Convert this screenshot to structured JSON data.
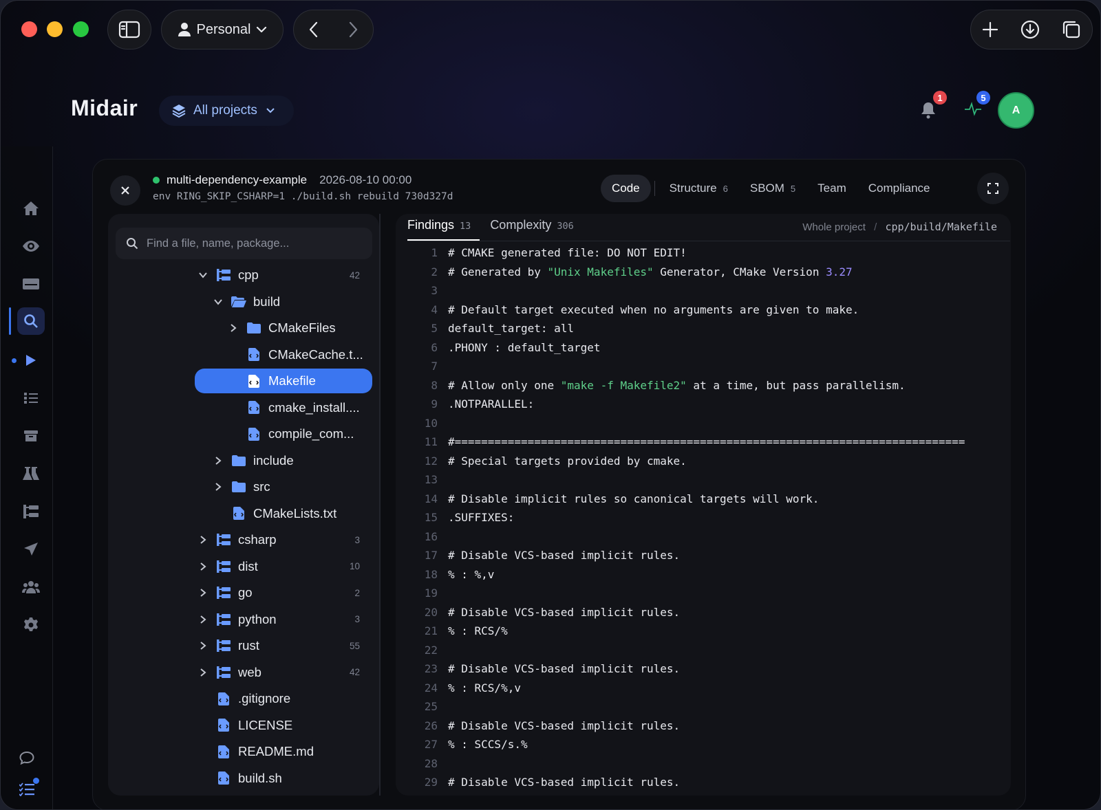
{
  "titlebar": {
    "profile_label": "Personal"
  },
  "header": {
    "brand": "Midair",
    "project_selector": "All projects",
    "notifications_count": "1",
    "activity_count": "5",
    "avatar_initial": "A"
  },
  "run": {
    "repo_name": "multi-dependency-example",
    "timestamp": "2026-08-10 00:00",
    "command": "env RING_SKIP_CSHARP=1 ./build.sh rebuild  730d327d"
  },
  "tabs": [
    {
      "label": "Code",
      "count": ""
    },
    {
      "label": "Structure",
      "count": "6"
    },
    {
      "label": "SBOM",
      "count": "5"
    },
    {
      "label": "Team",
      "count": ""
    },
    {
      "label": "Compliance",
      "count": ""
    }
  ],
  "tree": {
    "search_placeholder": "Find a file, name, package...",
    "nodes": [
      {
        "label": "cpp",
        "count": "42"
      },
      {
        "label": "build",
        "count": ""
      },
      {
        "label": "CMakeFiles",
        "count": ""
      },
      {
        "label": "CMakeCache.t...",
        "count": ""
      },
      {
        "label": "Makefile",
        "count": ""
      },
      {
        "label": "cmake_install....",
        "count": ""
      },
      {
        "label": "compile_com...",
        "count": ""
      },
      {
        "label": "include",
        "count": ""
      },
      {
        "label": "src",
        "count": ""
      },
      {
        "label": "CMakeLists.txt",
        "count": ""
      },
      {
        "label": "csharp",
        "count": "3"
      },
      {
        "label": "dist",
        "count": "10"
      },
      {
        "label": "go",
        "count": "2"
      },
      {
        "label": "python",
        "count": "3"
      },
      {
        "label": "rust",
        "count": "55"
      },
      {
        "label": "web",
        "count": "42"
      },
      {
        "label": ".gitignore",
        "count": ""
      },
      {
        "label": "LICENSE",
        "count": ""
      },
      {
        "label": "README.md",
        "count": ""
      },
      {
        "label": "build.sh",
        "count": ""
      }
    ]
  },
  "code_tabs": [
    {
      "label": "Findings",
      "count": "13"
    },
    {
      "label": "Complexity",
      "count": "306"
    }
  ],
  "breadcrumb": {
    "root": "Whole project",
    "separator": "/",
    "path": "cpp/build/Makefile"
  },
  "code_lines": [
    {
      "n": "1",
      "parts": [
        {
          "t": "# CMAKE generated file: DO NOT EDIT!"
        }
      ]
    },
    {
      "n": "2",
      "parts": [
        {
          "t": "# Generated by "
        },
        {
          "t": "\"Unix Makefiles\"",
          "c": "s"
        },
        {
          "t": " Generator, CMake Version "
        },
        {
          "t": "3.27",
          "c": "v"
        }
      ]
    },
    {
      "n": "3",
      "parts": []
    },
    {
      "n": "4",
      "parts": [
        {
          "t": "# Default target executed when no arguments are given to make."
        }
      ]
    },
    {
      "n": "5",
      "parts": [
        {
          "t": "default_target: all"
        }
      ]
    },
    {
      "n": "6",
      "parts": [
        {
          "t": ".PHONY : default_target"
        }
      ]
    },
    {
      "n": "7",
      "parts": []
    },
    {
      "n": "8",
      "parts": [
        {
          "t": "# Allow only one "
        },
        {
          "t": "\"make -f Makefile2\"",
          "c": "s"
        },
        {
          "t": " at a time, but pass parallelism."
        }
      ]
    },
    {
      "n": "9",
      "parts": [
        {
          "t": ".NOTPARALLEL:"
        }
      ]
    },
    {
      "n": "10",
      "parts": []
    },
    {
      "n": "11",
      "parts": [
        {
          "t": "#============================================================================="
        }
      ]
    },
    {
      "n": "12",
      "parts": [
        {
          "t": "# Special targets provided by cmake."
        }
      ]
    },
    {
      "n": "13",
      "parts": []
    },
    {
      "n": "14",
      "parts": [
        {
          "t": "# Disable implicit rules so canonical targets will work."
        }
      ]
    },
    {
      "n": "15",
      "parts": [
        {
          "t": ".SUFFIXES:"
        }
      ]
    },
    {
      "n": "16",
      "parts": []
    },
    {
      "n": "17",
      "parts": [
        {
          "t": "# Disable VCS-based implicit rules."
        }
      ]
    },
    {
      "n": "18",
      "parts": [
        {
          "t": "% : %,v"
        }
      ]
    },
    {
      "n": "19",
      "parts": []
    },
    {
      "n": "20",
      "parts": [
        {
          "t": "# Disable VCS-based implicit rules."
        }
      ]
    },
    {
      "n": "21",
      "parts": [
        {
          "t": "% : RCS/%"
        }
      ]
    },
    {
      "n": "22",
      "parts": []
    },
    {
      "n": "23",
      "parts": [
        {
          "t": "# Disable VCS-based implicit rules."
        }
      ]
    },
    {
      "n": "24",
      "parts": [
        {
          "t": "% : RCS/%,v"
        }
      ]
    },
    {
      "n": "25",
      "parts": []
    },
    {
      "n": "26",
      "parts": [
        {
          "t": "# Disable VCS-based implicit rules."
        }
      ]
    },
    {
      "n": "27",
      "parts": [
        {
          "t": "% : SCCS/s.%"
        }
      ]
    },
    {
      "n": "28",
      "parts": []
    },
    {
      "n": "29",
      "parts": [
        {
          "t": "# Disable VCS-based implicit rules."
        }
      ]
    }
  ],
  "colors": {
    "accent": "#3b76f0",
    "status_green": "#2fc26d",
    "string": "#5fd08a",
    "number": "#9b8cff",
    "notif_red": "#e5484d",
    "activity_blue": "#3366f0"
  }
}
